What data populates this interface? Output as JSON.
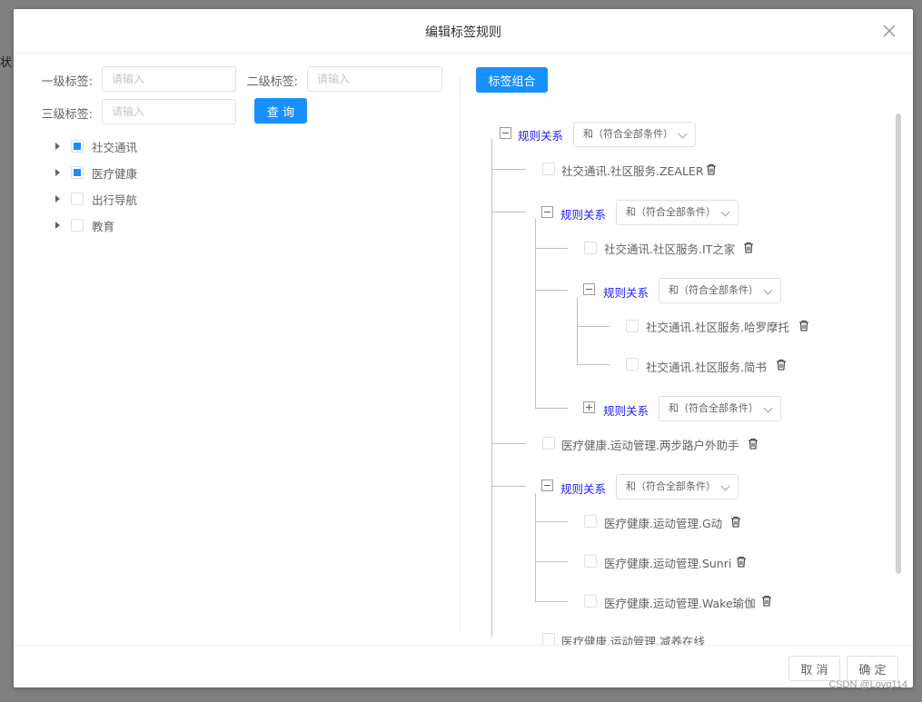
{
  "background": {
    "fragment": "状"
  },
  "dialog": {
    "title": "编辑标签规则",
    "close_icon": "close-icon"
  },
  "filters": {
    "level1": {
      "label": "一级标签:",
      "placeholder": "请输入",
      "value": ""
    },
    "level2": {
      "label": "二级标签:",
      "placeholder": "请输入",
      "value": ""
    },
    "level3": {
      "label": "三级标签:",
      "placeholder": "请输入",
      "value": ""
    },
    "search_button": "查 询"
  },
  "category_tree": [
    {
      "label": "社交通讯",
      "state": "partial"
    },
    {
      "label": "医疗健康",
      "state": "partial"
    },
    {
      "label": "出行导航",
      "state": "unchecked"
    },
    {
      "label": "教育",
      "state": "unchecked"
    }
  ],
  "rule_panel": {
    "combine_button": "标签组合",
    "rule_label": "规则关系",
    "operator_option": "和（符合全部条件）",
    "leaves": [
      "社交通讯.社区服务.ZEALER",
      "社交通讯.社区服务.IT之家",
      "社交通讯.社区服务.哈罗摩托",
      "社交通讯.社区服务.简书",
      "医疗健康.运动管理.两步路户外助手",
      "医疗健康.运动管理.G动",
      "医疗健康.运动管理.Sunri",
      "医疗健康.运动管理.Wake瑜伽",
      "医疗健康.运动管理.减养在线"
    ]
  },
  "footer": {
    "cancel": "取 消",
    "confirm": "确 定"
  },
  "watermark": "CSDN @Lovq114",
  "colors": {
    "primary": "#1890ff",
    "rule_link": "#1a1aff"
  }
}
